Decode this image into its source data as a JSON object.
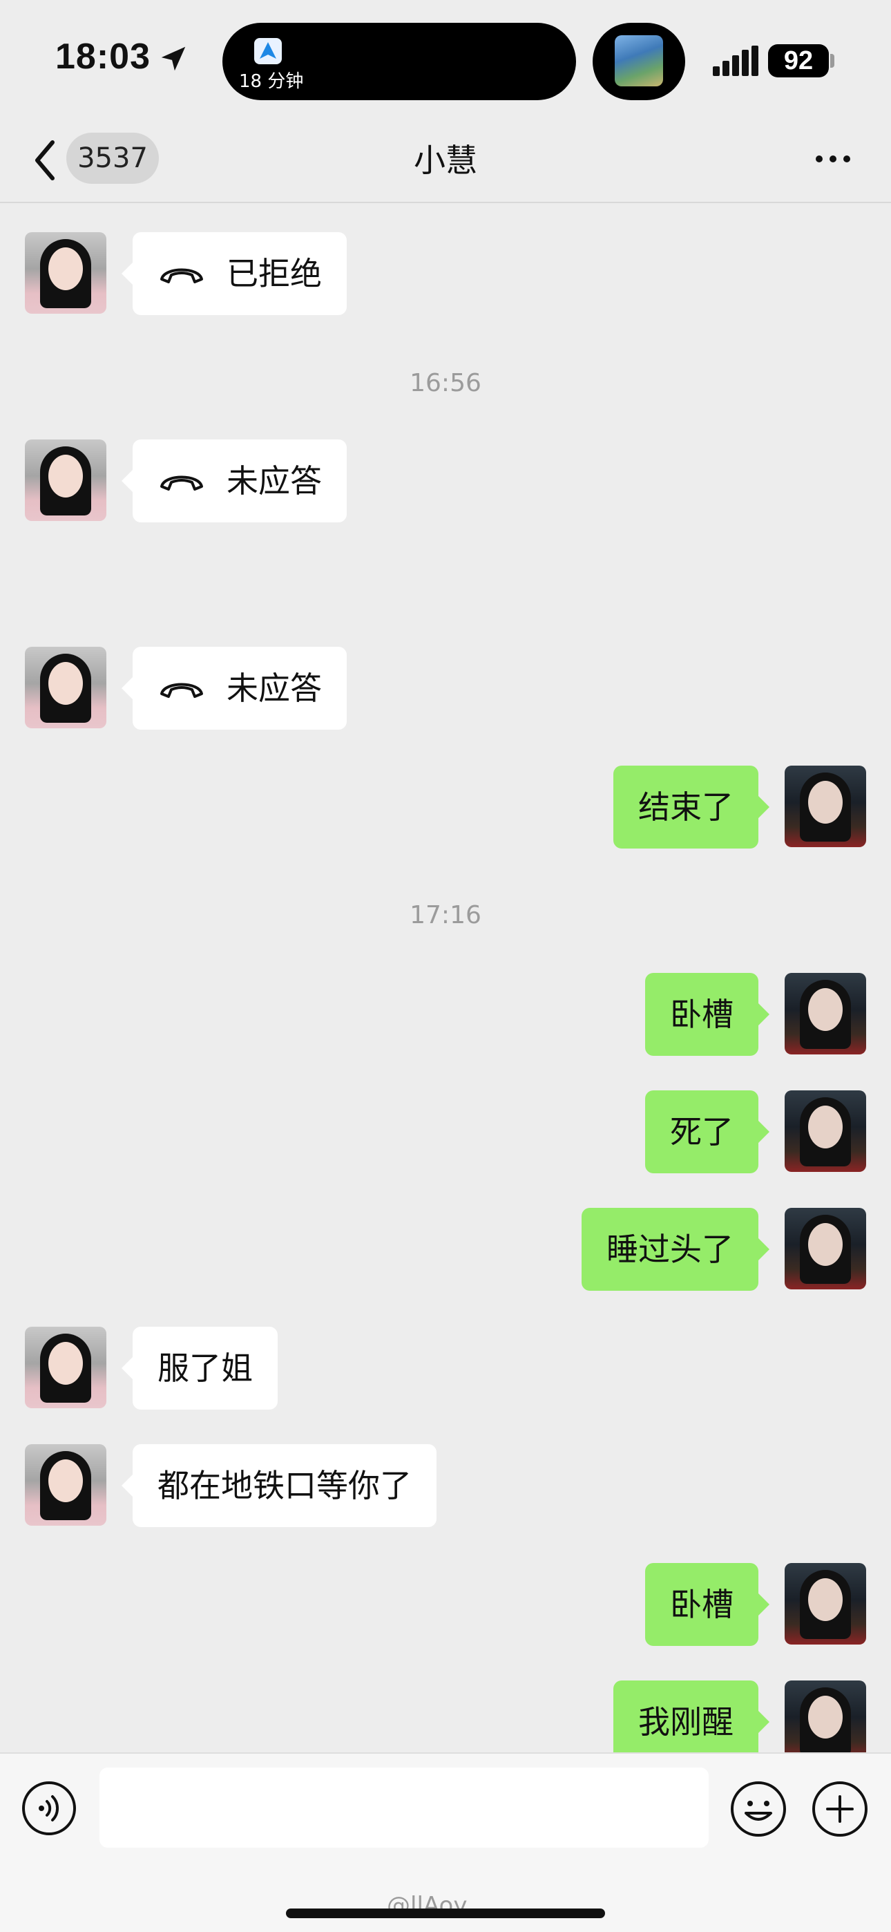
{
  "status_bar": {
    "time": "18:03",
    "island_text": "18 分钟",
    "battery": "92"
  },
  "nav": {
    "unread_count": "3537",
    "title": "小慧"
  },
  "messages": [
    {
      "side": "in",
      "kind": "call",
      "text": "已拒绝"
    },
    {
      "kind": "timestamp",
      "text": "16:56"
    },
    {
      "side": "in",
      "kind": "call",
      "text": "未应答"
    },
    {
      "side": "in",
      "kind": "call",
      "text": "未应答"
    },
    {
      "side": "out",
      "kind": "text",
      "text": "结束了"
    },
    {
      "kind": "timestamp",
      "text": "17:16"
    },
    {
      "side": "out",
      "kind": "text",
      "text": "卧槽"
    },
    {
      "side": "out",
      "kind": "text",
      "text": "死了"
    },
    {
      "side": "out",
      "kind": "text",
      "text": "睡过头了"
    },
    {
      "side": "in",
      "kind": "text",
      "text": "服了姐"
    },
    {
      "side": "in",
      "kind": "text",
      "text": "都在地铁口等你了"
    },
    {
      "side": "out",
      "kind": "text",
      "text": "卧槽"
    },
    {
      "side": "out",
      "kind": "text",
      "text": "我刚醒"
    }
  ],
  "input": {
    "value": "",
    "placeholder": ""
  },
  "watermark": "@llAoy",
  "icons": {
    "location": "location-arrow-icon",
    "back": "chevron-left-icon",
    "more": "more-dots-icon",
    "call": "phone-hangup-icon",
    "voice": "voice-icon",
    "emoji": "emoji-icon",
    "plus": "plus-icon"
  },
  "colors": {
    "background": "#ededed",
    "outgoing_bubble": "#95ec69",
    "incoming_bubble": "#ffffff",
    "timestamp": "#9b9b9b"
  }
}
